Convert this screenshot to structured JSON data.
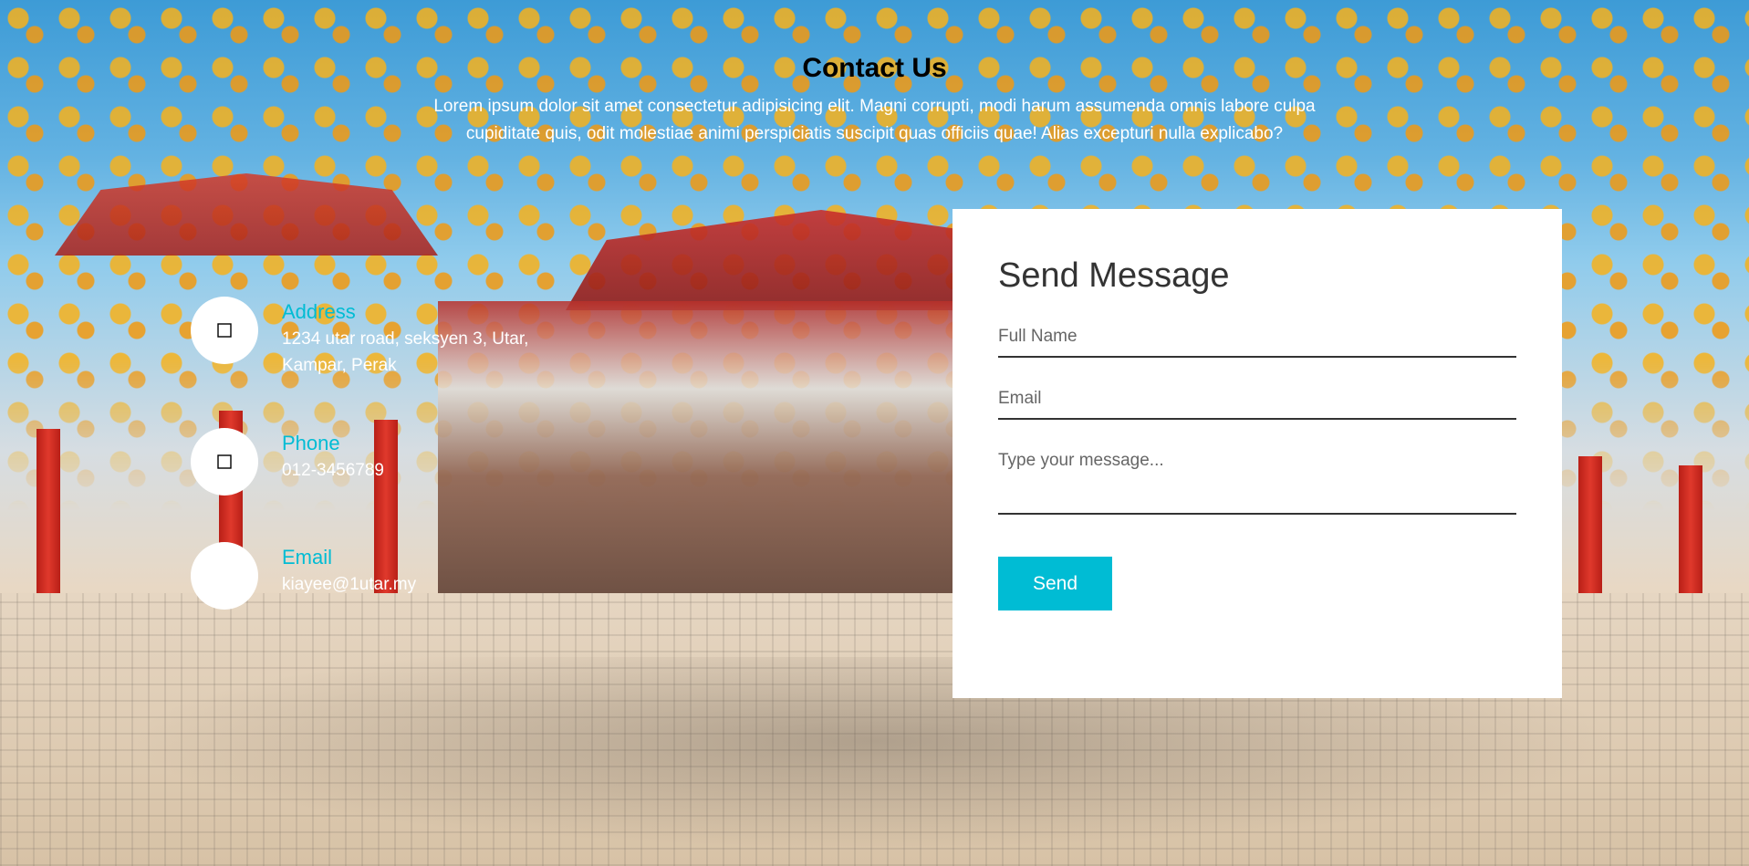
{
  "header": {
    "title": "Contact Us",
    "description": "Lorem ipsum dolor sit amet consectetur adipisicing elit. Magni corrupti, modi harum assumenda omnis labore culpa cupiditate quis, odit molestiae animi perspiciatis suscipit quas officiis quae! Alias excepturi nulla explicabo?"
  },
  "contact_info": {
    "address": {
      "label": "Address",
      "value": "1234 utar road, seksyen 3, Utar, Kampar, Perak",
      "icon": "map-marker-icon"
    },
    "phone": {
      "label": "Phone",
      "value": "012-3456789",
      "icon": "phone-icon"
    },
    "email": {
      "label": "Email",
      "value": "kiayee@1utar.my",
      "icon": "envelope-icon"
    }
  },
  "form": {
    "title": "Send Message",
    "full_name_placeholder": "Full Name",
    "email_placeholder": "Email",
    "message_placeholder": "Type your message...",
    "send_label": "Send"
  },
  "colors": {
    "accent": "#00bcd4",
    "card_bg": "#ffffff",
    "text_dark": "#333333"
  }
}
